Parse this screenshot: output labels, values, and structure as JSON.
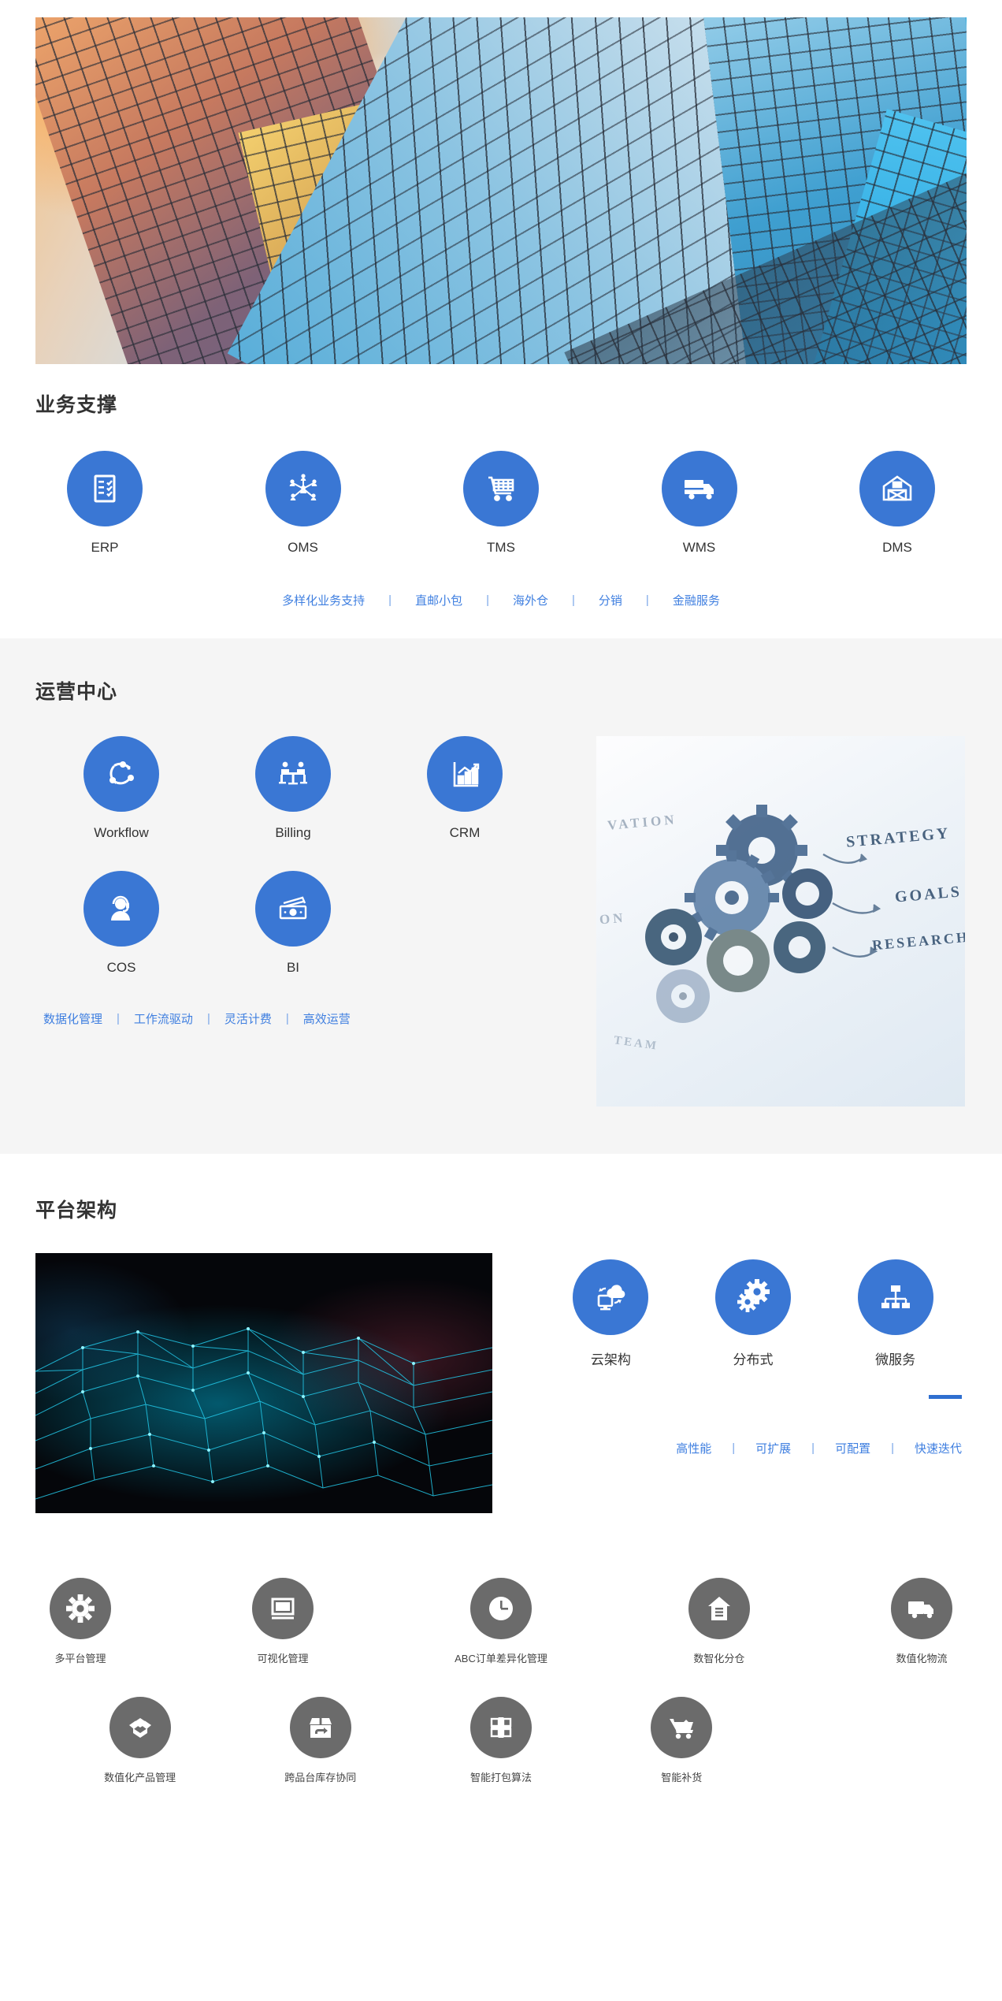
{
  "hero": {
    "alt": "city-skyscrapers-banner"
  },
  "sections": {
    "business": {
      "title": "业务支撑",
      "icons": [
        {
          "label": "ERP",
          "icon": "clipboard-checklist-icon"
        },
        {
          "label": "OMS",
          "icon": "network-users-icon"
        },
        {
          "label": "TMS",
          "icon": "shopping-cart-icon"
        },
        {
          "label": "WMS",
          "icon": "delivery-truck-icon"
        },
        {
          "label": "DMS",
          "icon": "warehouse-barn-icon"
        }
      ],
      "links": [
        "多样化业务支持",
        "直邮小包",
        "海外仓",
        "分销",
        "金融服务"
      ]
    },
    "operations": {
      "title": "运营中心",
      "icons": [
        {
          "label": "Workflow",
          "icon": "circular-arrows-icon"
        },
        {
          "label": "Billing",
          "icon": "people-at-table-icon"
        },
        {
          "label": "CRM",
          "icon": "bar-chart-growth-icon"
        },
        {
          "label": "COS",
          "icon": "headset-agent-icon"
        },
        {
          "label": "BI",
          "icon": "money-cash-icon"
        }
      ],
      "links": [
        "数据化管理",
        "工作流驱动",
        "灵活计费",
        "高效运营"
      ],
      "image": {
        "alt": "gears-strategy-photo",
        "words": {
          "strategy": "STRATEGY",
          "goals": "GOALS",
          "research": "RESEARCH",
          "innovation": "VATION",
          "on": "ON",
          "team": "TEAM"
        }
      }
    },
    "platform": {
      "title": "平台架构",
      "image": {
        "alt": "blue-network-mesh-photo"
      },
      "icons": [
        {
          "label": "云架构",
          "icon": "cloud-sync-monitor-icon"
        },
        {
          "label": "分布式",
          "icon": "two-gears-icon"
        },
        {
          "label": "微服务",
          "icon": "org-tree-icon"
        }
      ],
      "links": [
        "高性能",
        "可扩展",
        "可配置",
        "快速迭代"
      ]
    },
    "features": {
      "row1": [
        {
          "label": "多平台管理",
          "icon": "gear-icon"
        },
        {
          "label": "可视化管理",
          "icon": "monitor-icon"
        },
        {
          "label": "ABC订单差异化管理",
          "icon": "clock-icon"
        },
        {
          "label": "数智化分仓",
          "icon": "warehouse-doc-icon"
        },
        {
          "label": "数值化物流",
          "icon": "truck-icon"
        }
      ],
      "row2": [
        {
          "label": "数值化产品管理",
          "icon": "open-box-icon"
        },
        {
          "label": "跨品台库存协同",
          "icon": "box-return-icon"
        },
        {
          "label": "智能打包算法",
          "icon": "package-grid-icon"
        },
        {
          "label": "智能补货",
          "icon": "cart-icon"
        }
      ]
    }
  },
  "separator": "|",
  "colors": {
    "accent_blue": "#3a77d4",
    "link_blue": "#3f7fe0",
    "gray_circle": "#6b6b6b",
    "section_bg": "#f5f5f5",
    "heading": "#333333"
  }
}
